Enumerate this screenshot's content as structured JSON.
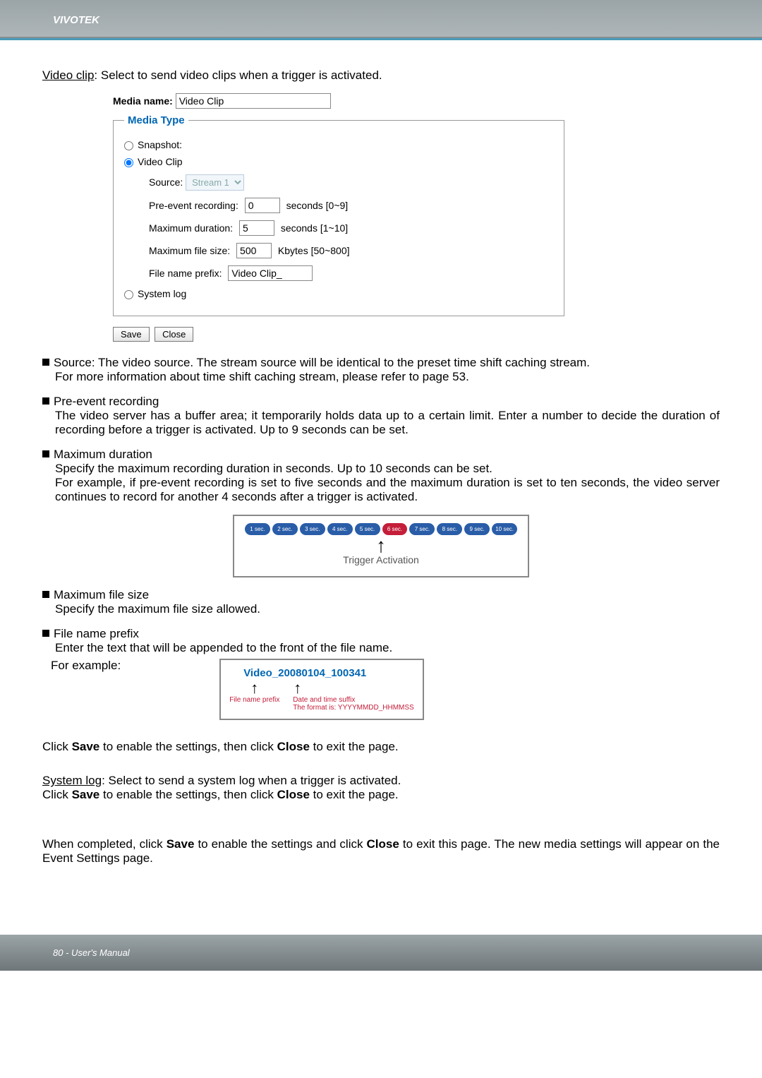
{
  "header": {
    "brand": "VIVOTEK"
  },
  "intro": {
    "underlined": "Video clip",
    "rest": ": Select to send video clips when a trigger is activated."
  },
  "form": {
    "media_name_label": "Media name:",
    "media_name_value": "Video Clip",
    "fieldset_legend": "Media Type",
    "snapshot_label": "Snapshot:",
    "videoclip_label": "Video Clip",
    "source_label": "Source:",
    "source_value": "Stream 1",
    "preevent_label": "Pre-event recording:",
    "preevent_value": "0",
    "preevent_unit": "seconds [0~9]",
    "maxdur_label": "Maximum duration:",
    "maxdur_value": "5",
    "maxdur_unit": "seconds [1~10]",
    "maxsize_label": "Maximum file size:",
    "maxsize_value": "500",
    "maxsize_unit": "Kbytes [50~800]",
    "prefix_label": "File name prefix:",
    "prefix_value": "Video Clip_",
    "syslog_label": "System log",
    "save_btn": "Save",
    "close_btn": "Close"
  },
  "bullets": {
    "source_title": "Source: The video source. The stream source will be identical to the preset time shift caching stream.",
    "source_body": "For more information about time shift caching stream, please refer to page 53.",
    "preevent_title": "Pre-event recording",
    "preevent_body": "The video server has a buffer area; it temporarily holds data up to a certain limit. Enter a number to decide the duration of recording before a trigger is activated. Up to 9 seconds can be set.",
    "maxdur_title": "Maximum duration",
    "maxdur_body1": "Specify the maximum recording duration in seconds. Up to 10 seconds can be set.",
    "maxdur_body2": "For example, if pre-event recording is set to five seconds and the maximum duration is set to ten seconds, the video server continues to record for another 4 seconds after a trigger is activated.",
    "maxsize_title": "Maximum file size",
    "maxsize_body": "Specify the maximum file size allowed.",
    "prefix_title": "File name prefix",
    "prefix_body": "Enter the text that will be appended to the front of the file name.",
    "for_example": "For example:"
  },
  "timeline": {
    "pills": [
      "1 sec.",
      "2 sec.",
      "3 sec.",
      "4 sec.",
      "5 sec.",
      "6 sec.",
      "7 sec.",
      "8 sec.",
      "9 sec.",
      "10 sec."
    ],
    "active_index": 5,
    "caption": "Trigger Activation"
  },
  "filename_diagram": {
    "example": "Video_20080104_100341",
    "label1": "File name prefix",
    "label2": "Date and time suffix",
    "label3": "The format is: YYYYMMDD_HHMMSS"
  },
  "closing": {
    "para1a": "Click ",
    "para1b": "Save",
    "para1c": " to enable the settings, then click ",
    "para1d": "Close",
    "para1e": " to exit the page.",
    "syslog_underlined": "System log",
    "syslog_rest": ": Select to send a system log when a trigger is activated.",
    "para2a": "Click ",
    "para2b": "Save",
    "para2c": " to enable the settings, then click ",
    "para2d": "Close",
    "para2e": " to exit the page.",
    "final_a": "When completed, click ",
    "final_b": "Save",
    "final_c": " to enable the settings and click ",
    "final_d": "Close",
    "final_e": " to exit this page. The new media settings will appear on the Event Settings page."
  },
  "footer": {
    "text": "80 - User's Manual"
  }
}
